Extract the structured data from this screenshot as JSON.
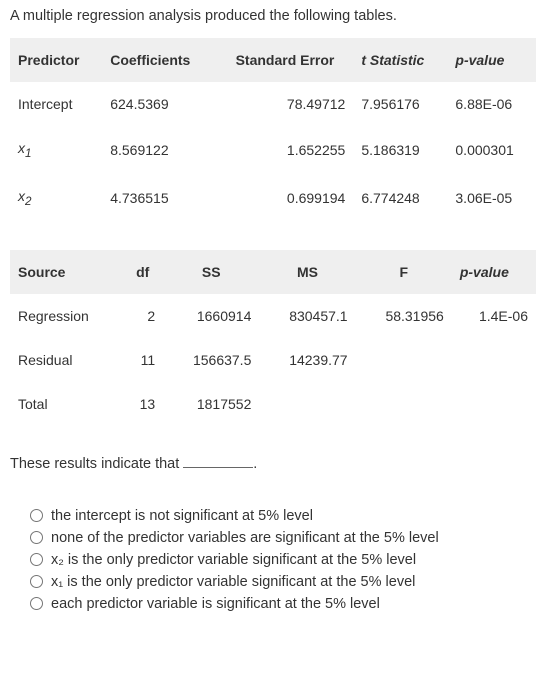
{
  "intro": "A multiple regression analysis produced the following tables.",
  "table1": {
    "headers": [
      "Predictor",
      "Coefficients",
      "Standard Error",
      "t Statistic",
      "p-value"
    ],
    "rows": [
      {
        "predictor": "Intercept",
        "coef": "624.5369",
        "se": "78.49712",
        "t": "7.956176",
        "p": "6.88E-06"
      },
      {
        "predictor": "x1",
        "coef": "8.569122",
        "se": "1.652255",
        "t": "5.186319",
        "p": "0.000301"
      },
      {
        "predictor": "x2",
        "coef": "4.736515",
        "se": "0.699194",
        "t": "6.774248",
        "p": "3.06E-05"
      }
    ]
  },
  "table2": {
    "headers": [
      "Source",
      "df",
      "SS",
      "MS",
      "F",
      "p-value"
    ],
    "rows": [
      {
        "source": "Regression",
        "df": "2",
        "ss": "1660914",
        "ms": "830457.1",
        "f": "58.31956",
        "p": "1.4E-06"
      },
      {
        "source": "Residual",
        "df": "11",
        "ss": "156637.5",
        "ms": "14239.77",
        "f": "",
        "p": ""
      },
      {
        "source": "Total",
        "df": "13",
        "ss": "1817552",
        "ms": "",
        "f": "",
        "p": ""
      }
    ]
  },
  "prompt_prefix": "These results indicate that ",
  "prompt_suffix": ".",
  "options": [
    "the intercept is not significant at 5% level",
    "none of the predictor variables are significant at the 5% level",
    "x₂ is the only predictor variable significant at the 5% level",
    "x₁ is the only predictor variable significant at the 5% level",
    "each predictor variable is significant at the 5% level"
  ]
}
